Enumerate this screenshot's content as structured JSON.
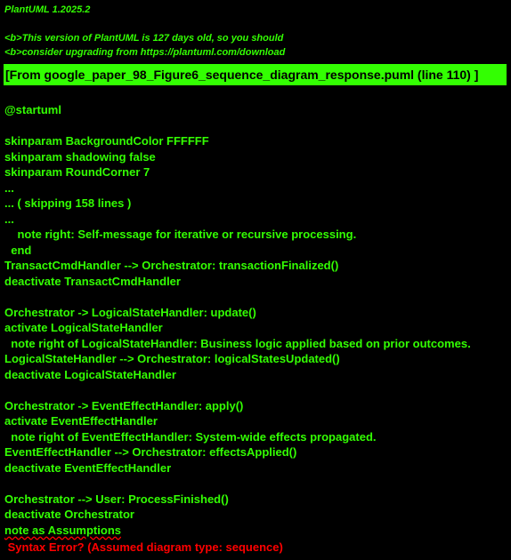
{
  "header": {
    "version": "PlantUML 1.2025.2",
    "warning_line1": "<b>This version of PlantUML is 127 days old, so you should",
    "warning_line2": "<b>consider upgrading from https://plantuml.com/download"
  },
  "banner": {
    "text": "[From google_paper_98_Figure6_sequence_diagram_response.puml (line 110) ]"
  },
  "source_lines": [
    "@startuml",
    "",
    "skinparam BackgroundColor FFFFFF",
    "skinparam shadowing false",
    "skinparam RoundCorner 7",
    "...",
    "... ( skipping 158 lines )",
    "...",
    "    note right: Self-message for iterative or recursive processing.",
    "  end",
    "TransactCmdHandler --> Orchestrator: transactionFinalized()",
    "deactivate TransactCmdHandler",
    "",
    "Orchestrator -> LogicalStateHandler: update()",
    "activate LogicalStateHandler",
    "  note right of LogicalStateHandler: Business logic applied based on prior outcomes.",
    "LogicalStateHandler --> Orchestrator: logicalStatesUpdated()",
    "deactivate LogicalStateHandler",
    "",
    "Orchestrator -> EventEffectHandler: apply()",
    "activate EventEffectHandler",
    "  note right of EventEffectHandler: System-wide effects propagated.",
    "EventEffectHandler --> Orchestrator: effectsApplied()",
    "deactivate EventEffectHandler",
    "",
    "Orchestrator --> User: ProcessFinished()",
    "deactivate Orchestrator",
    "note as Assumptions"
  ],
  "error": {
    "text": " Syntax Error? (Assumed diagram type: sequence)"
  },
  "colors": {
    "background": "#000000",
    "text": "#33FF02",
    "banner_bg": "#33FF02",
    "banner_text": "#000000",
    "error": "#FF0000"
  }
}
